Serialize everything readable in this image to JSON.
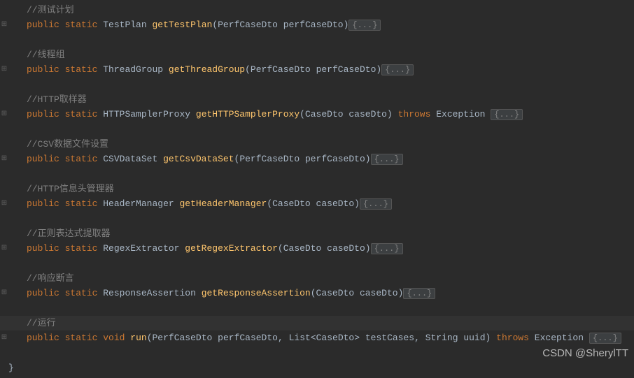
{
  "code": {
    "comment1": "//测试计划",
    "m1_pub": "public",
    "m1_static": "static",
    "m1_ret": "TestPlan",
    "m1_name": "getTestPlan",
    "m1_ptype": "PerfCaseDto",
    "m1_pname": "perfCaseDto",
    "fold": "{...}",
    "comment2": "//线程组",
    "m2_ret": "ThreadGroup",
    "m2_name": "getThreadGroup",
    "m2_ptype": "PerfCaseDto",
    "m2_pname": "perfCaseDto",
    "comment3": "//HTTP取样器",
    "m3_ret": "HTTPSamplerProxy",
    "m3_name": "getHTTPSamplerProxy",
    "m3_ptype": "CaseDto",
    "m3_pname": "caseDto",
    "m3_throws": "throws",
    "m3_exc": "Exception",
    "comment4": "//CSV数据文件设置",
    "m4_ret": "CSVDataSet",
    "m4_name": "getCsvDataSet",
    "m4_ptype": "PerfCaseDto",
    "m4_pname": "perfCaseDto",
    "comment5": "//HTTP信息头管理器",
    "m5_ret": "HeaderManager",
    "m5_name": "getHeaderManager",
    "m5_ptype": "CaseDto",
    "m5_pname": "caseDto",
    "comment6": "//正则表达式提取器",
    "m6_ret": "RegexExtractor",
    "m6_name": "getRegexExtractor",
    "m6_ptype": "CaseDto",
    "m6_pname": "caseDto",
    "comment7": "//响应断言",
    "m7_ret": "ResponseAssertion",
    "m7_name": "getResponseAssertion",
    "m7_ptype": "CaseDto",
    "m7_pname": "caseDto",
    "comment8": "//运行",
    "m8_ret": "void",
    "m8_name": "run",
    "m8_p1type": "PerfCaseDto",
    "m8_p1name": "perfCaseDto",
    "m8_p2type": "List",
    "m8_p2gen": "CaseDto",
    "m8_p2name": "testCases",
    "m8_p3type": "String",
    "m8_p3name": "uuid",
    "m8_throws": "throws",
    "m8_exc": "Exception",
    "close_brace": "}"
  },
  "watermark": "CSDN @SherylTT"
}
